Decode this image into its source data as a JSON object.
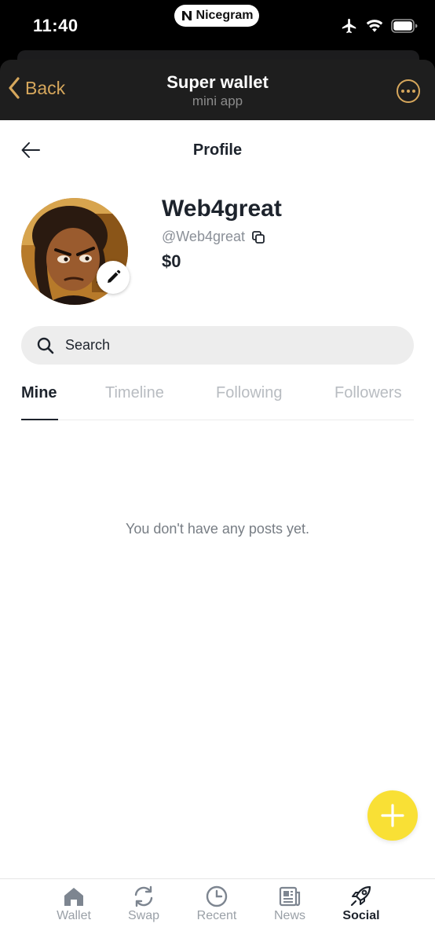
{
  "status_bar": {
    "time": "11:40",
    "island_label": "Nicegram",
    "icons": [
      "airplane-icon",
      "wifi-icon",
      "battery-icon"
    ]
  },
  "header": {
    "back_label": "Back",
    "title": "Super wallet",
    "subtitle": "mini app",
    "accent_color": "#d6a75c"
  },
  "profile": {
    "page_title": "Profile",
    "display_name": "Web4great",
    "handle": "@Web4great",
    "balance": "$0"
  },
  "search": {
    "placeholder": "Search"
  },
  "tabs": [
    {
      "label": "Mine",
      "active": true
    },
    {
      "label": "Timeline",
      "active": false
    },
    {
      "label": "Following",
      "active": false
    },
    {
      "label": "Followers",
      "active": false
    }
  ],
  "empty_state": {
    "message": "You don't have any posts yet."
  },
  "fab": {
    "icon": "plus-icon",
    "color": "#f9e035"
  },
  "bottom_nav": [
    {
      "label": "Wallet",
      "icon": "home-icon",
      "active": false
    },
    {
      "label": "Swap",
      "icon": "swap-icon",
      "active": false
    },
    {
      "label": "Recent",
      "icon": "clock-icon",
      "active": false
    },
    {
      "label": "News",
      "icon": "newspaper-icon",
      "active": false
    },
    {
      "label": "Social",
      "icon": "rocket-icon",
      "active": true
    }
  ]
}
